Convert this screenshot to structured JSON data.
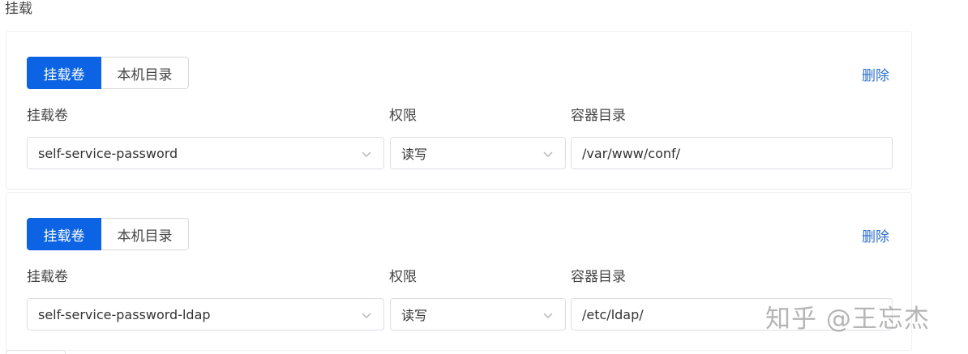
{
  "section": {
    "title": "挂载"
  },
  "mounts": [
    {
      "tabs": {
        "active": "挂载卷",
        "inactive": "本机目录"
      },
      "delete_label": "删除",
      "labels": {
        "volume": "挂载卷",
        "permission": "权限",
        "container_dir": "容器目录"
      },
      "volume_value": "self-service-password",
      "permission_value": "读写",
      "container_dir_value": "/var/www/conf/"
    },
    {
      "tabs": {
        "active": "挂载卷",
        "inactive": "本机目录"
      },
      "delete_label": "删除",
      "labels": {
        "volume": "挂载卷",
        "permission": "权限",
        "container_dir": "容器目录"
      },
      "volume_value": "self-service-password-ldap",
      "permission_value": "读写",
      "container_dir_value": "/etc/ldap/"
    }
  ],
  "watermark": "知乎 @王忘杰",
  "colors": {
    "primary": "#0c63e4",
    "link": "#2a6fc9",
    "border": "#dcdfe6"
  },
  "icons": {
    "select_arrow": "chevron-down-icon"
  }
}
